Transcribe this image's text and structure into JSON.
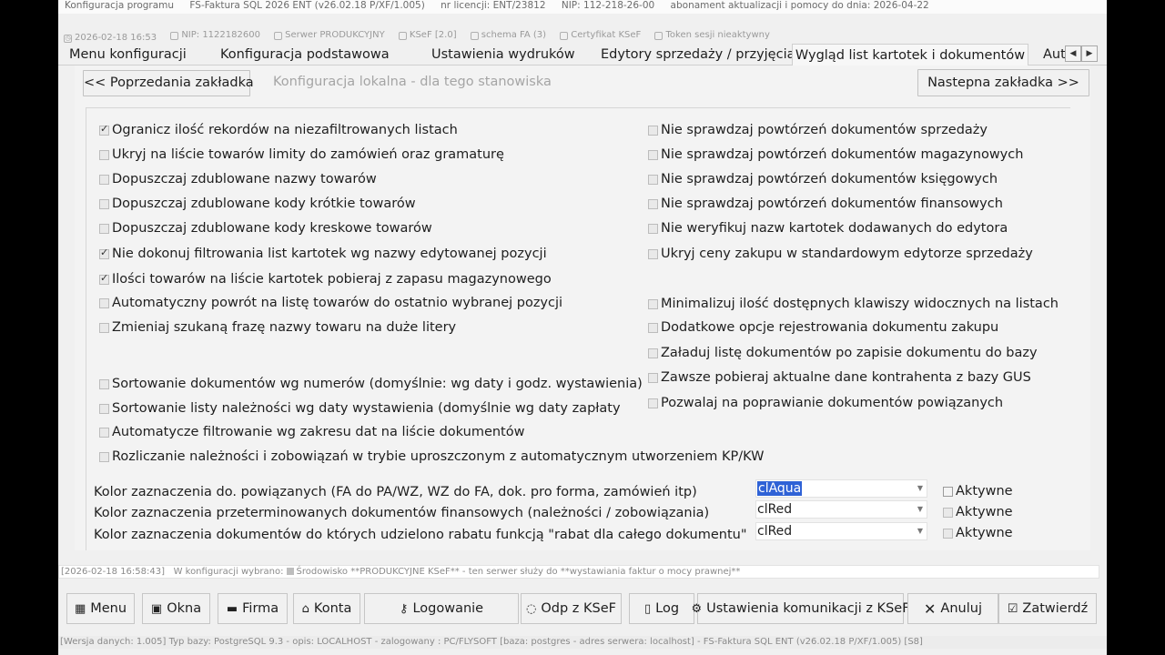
{
  "titlebar": {
    "app": "Konfiguracja programu",
    "product": "FS-Faktura SQL 2026 ENT (v26.02.18 P/XF/1.005)",
    "license": "nr licencji: ENT/23812",
    "nip": "NIP: 112-218-26-00",
    "subscription": "abonament aktualizacji i pomocy do dnia:  2026-04-22"
  },
  "status": {
    "datetime": "2026-02-18  16:53",
    "nip": "NIP: 1122182600",
    "server": "Serwer PRODUKCYJNY",
    "ksef": "KSeF [2.0]",
    "schema": "schema FA (3)",
    "cert": "Certyfikat KSeF",
    "token": "Token sesji nieaktywny"
  },
  "tabs": [
    {
      "label": "Menu konfiguracji"
    },
    {
      "label": "Konfiguracja podstawowa"
    },
    {
      "label": "Ustawienia wydruków"
    },
    {
      "label": "Edytory sprzedaży / przyjęcia"
    },
    {
      "label": "Wygląd list kartotek i dokumentów"
    },
    {
      "label": "Aut"
    }
  ],
  "nav": {
    "prev": "<< Poprzedania zakładka",
    "local": "Konfiguracja lokalna - dla tego stanowiska",
    "next": "Nastepna zakładka >>"
  },
  "left_options": [
    {
      "label": "Ogranicz ilość rekordów na niezafiltrowanych listach",
      "checked": true
    },
    {
      "label": "Ukryj na liście towarów limity do zamówień oraz gramaturę",
      "checked": false
    },
    {
      "label": "Dopuszczaj zdublowane nazwy towarów",
      "checked": false
    },
    {
      "label": "Dopuszczaj zdublowane kody krótkie towarów",
      "checked": false
    },
    {
      "label": "Dopuszczaj zdublowane kody kreskowe towarów",
      "checked": false
    },
    {
      "label": "Nie dokonuj filtrowania list kartotek wg nazwy edytowanej pozycji",
      "checked": true
    },
    {
      "label": "Ilości towarów na liście kartotek pobieraj z zapasu magazynowego",
      "checked": true
    },
    {
      "label": "Automatyczny powrót na listę towarów do ostatnio wybranej pozycji",
      "checked": false
    },
    {
      "label": "Zmieniaj szukaną frazę nazwy towaru na duże litery",
      "checked": false
    },
    {
      "label": "Sortowanie dokumentów wg numerów  (domyślnie: wg daty i godz. wystawienia)",
      "checked": false
    },
    {
      "label": "Sortowanie listy należności wg daty wystawienia   (domyślnie wg daty zapłaty",
      "checked": false
    },
    {
      "label": "Automatycze filtrowanie wg zakresu dat na liście dokumentów",
      "checked": false
    },
    {
      "label": "Rozliczanie należności i zobowiązań w trybie uproszczonym z automatycznym utworzeniem KP/KW",
      "checked": false
    }
  ],
  "right_options": [
    {
      "label": "Nie sprawdzaj powtórzeń dokumentów sprzedaży",
      "checked": false
    },
    {
      "label": "Nie sprawdzaj powtórzeń dokumentów magazynowych",
      "checked": false
    },
    {
      "label": "Nie sprawdzaj powtórzeń dokumentów księgowych",
      "checked": false
    },
    {
      "label": "Nie sprawdzaj powtórzeń dokumentów finansowych",
      "checked": false
    },
    {
      "label": "Nie weryfikuj nazw kartotek dodawanych do edytora",
      "checked": false
    },
    {
      "label": "Ukryj ceny zakupu w standardowym edytorze sprzedaży",
      "checked": false
    },
    {
      "label": "Minimalizuj ilość dostępnych klawiszy widocznych na listach",
      "checked": false
    },
    {
      "label": "Dodatkowe opcje rejestrowania dokumentu zakupu",
      "checked": false
    },
    {
      "label": "Załaduj listę dokumentów po zapisie dokumentu do bazy",
      "checked": false
    },
    {
      "label": "Zawsze pobieraj aktualne dane kontrahenta z bazy GUS",
      "checked": false
    },
    {
      "label": "Pozwalaj na poprawianie dokumentów powiązanych",
      "checked": false
    }
  ],
  "colors": [
    {
      "label": "Kolor zaznaczenia do. powiązanych  (FA do PA/WZ, WZ do FA, dok. pro forma, zamówień itp)",
      "value": "clAqua",
      "active_label": "Aktywne",
      "active": false
    },
    {
      "label": "Kolor zaznaczenia przeterminowanych dokumentów finansowych (należności / zobowiązania)",
      "value": "clRed",
      "active_label": "Aktywne",
      "active": false
    },
    {
      "label": "Kolor zaznaczenia dokumentów do których udzielono rabatu funkcją \"rabat dla całego dokumentu\"",
      "value": "clRed",
      "active_label": "Aktywne",
      "active": false
    }
  ],
  "infoline": {
    "time": "[2026-02-18 16:58:43]",
    "prefix": "W konfiguracji wybrano:",
    "message": "Środowisko **PRODUKCYJNE KSeF** - ten serwer służy do **wystawiania faktur o mocy prawnej**"
  },
  "buttons": [
    {
      "label": "Menu",
      "icon": "calculator-icon"
    },
    {
      "label": "Okna",
      "icon": "windows-icon"
    },
    {
      "label": "Firma",
      "icon": "company-icon"
    },
    {
      "label": "Konta",
      "icon": "home-icon"
    },
    {
      "label": "Logowanie",
      "icon": "key-icon"
    },
    {
      "label": "Odp z KSeF",
      "icon": "chat-icon"
    },
    {
      "label": "Log",
      "icon": "document-icon"
    },
    {
      "label": "Ustawienia komunikacji z KSeF",
      "icon": "settings-icon"
    },
    {
      "label": "Anuluj",
      "icon": "close-icon"
    },
    {
      "label": "Zatwierdź",
      "icon": "check-icon"
    }
  ],
  "footer": "[Wersja danych: 1.005] Typ bazy: PostgreSQL 9.3 - opis: LOCALHOST - zalogowany : PC/FLYSOFT [baza: postgres - adres serwera: localhost]  - FS-Faktura SQL ENT (v26.02.18 P/XF/1.005) [S8]"
}
